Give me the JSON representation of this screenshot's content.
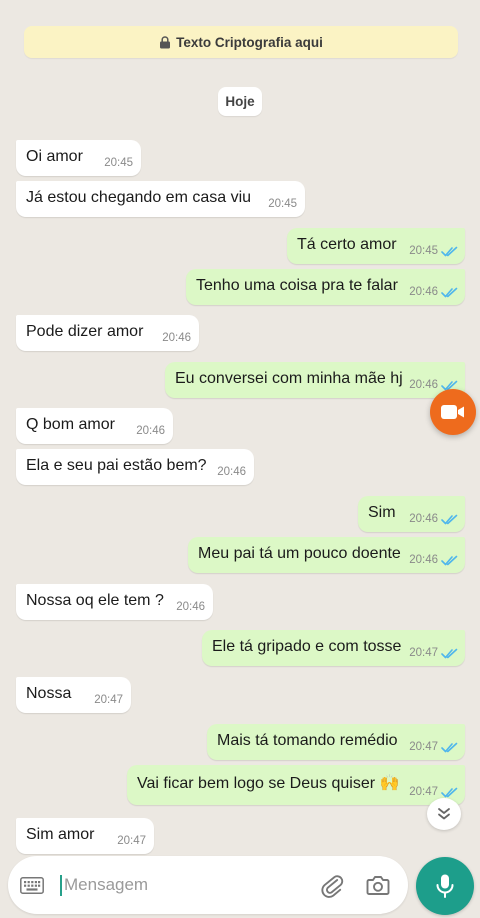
{
  "encryption_notice": "Texto Criptografia aqui",
  "date_chip": "Hoje",
  "messages": [
    {
      "direction": "in",
      "text": "Oi amor",
      "time": "20:45"
    },
    {
      "direction": "in",
      "text": "Já estou chegando em casa viu",
      "time": "20:45"
    },
    {
      "direction": "out",
      "text": "Tá certo amor",
      "time": "20:45",
      "status": "read"
    },
    {
      "direction": "out",
      "text": "Tenho uma coisa pra te falar",
      "time": "20:46",
      "status": "read"
    },
    {
      "direction": "in",
      "text": "Pode dizer amor",
      "time": "20:46"
    },
    {
      "direction": "out",
      "text": "Eu conversei com minha mãe hj",
      "time": "20:46",
      "status": "read"
    },
    {
      "direction": "in",
      "text": "Q bom amor",
      "time": "20:46"
    },
    {
      "direction": "in",
      "text": "Ela e seu pai estão bem?",
      "time": "20:46"
    },
    {
      "direction": "out",
      "text": "Sim",
      "time": "20:46",
      "status": "read"
    },
    {
      "direction": "out",
      "text": "Meu pai tá um pouco doente",
      "time": "20:46",
      "status": "read"
    },
    {
      "direction": "in",
      "text": "Nossa oq ele tem ?",
      "time": "20:46"
    },
    {
      "direction": "out",
      "text": "Ele tá gripado e com tosse",
      "time": "20:47",
      "status": "read"
    },
    {
      "direction": "in",
      "text": "Nossa",
      "time": "20:47"
    },
    {
      "direction": "out",
      "text": "Mais tá tomando remédio",
      "time": "20:47",
      "status": "read"
    },
    {
      "direction": "out",
      "text": "Vai ficar bem logo se Deus quiser 🙌",
      "time": "20:47",
      "status": "read"
    },
    {
      "direction": "in",
      "text": "Sim amor",
      "time": "20:47"
    }
  ],
  "composer": {
    "placeholder": "Mensagem",
    "value": ""
  },
  "icons": {
    "lock": "lock-icon",
    "ticks": "double-check-icon",
    "video": "video-camera-icon",
    "scroll": "chevron-double-down-icon",
    "keyboard": "keyboard-icon",
    "attach": "paperclip-icon",
    "camera": "camera-icon",
    "mic": "microphone-icon"
  },
  "colors": {
    "chat_background": "#ece8e2",
    "incoming_bubble": "#ffffff",
    "outgoing_bubble": "#dcf8c6",
    "read_ticks": "#4fb6ec",
    "encryption_banner": "#fbf3c4",
    "video_button": "#ee6b1d",
    "mic_button": "#1d9e8b"
  }
}
